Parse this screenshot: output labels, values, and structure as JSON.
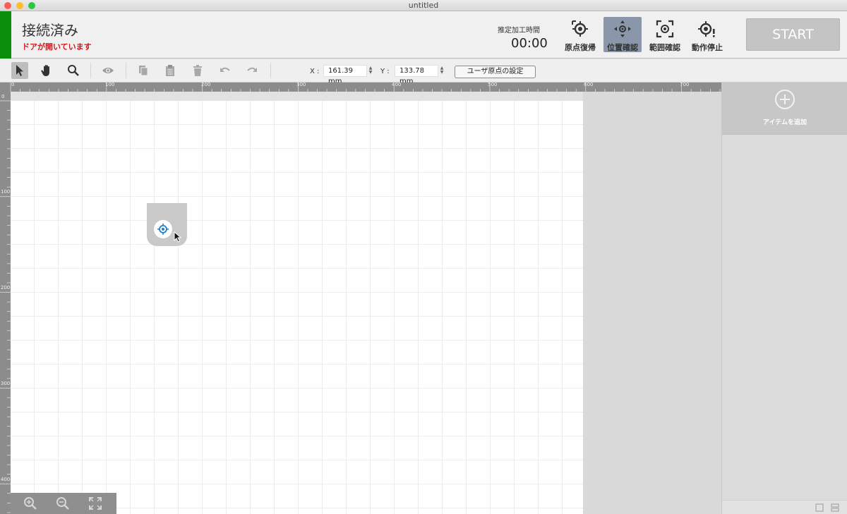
{
  "window": {
    "title": "untitled"
  },
  "status": {
    "connection": "接続済み",
    "warning": "ドアが開いています",
    "estimate_label": "推定加工時間",
    "estimate_time": "00:00",
    "status_color": "#0a8f0a",
    "warning_color": "#d4181c"
  },
  "header_buttons": [
    {
      "label": "原点復帰",
      "icon": "crosshair-home-icon"
    },
    {
      "label": "位置確認",
      "icon": "position-arrows-icon",
      "active": true
    },
    {
      "label": "範囲確認",
      "icon": "frame-target-icon"
    },
    {
      "label": "動作停止",
      "icon": "stop-target-icon"
    }
  ],
  "start_label": "START",
  "toolbar": {
    "tools": [
      "pointer-icon",
      "hand-icon",
      "zoom-icon",
      "eye-icon",
      "copy-icon",
      "paste-icon",
      "trash-icon",
      "undo-icon",
      "redo-icon"
    ],
    "x_label": "X :",
    "x_value": "161.39 mm",
    "y_label": "Y :",
    "y_value": "133.78 mm",
    "origin_button": "ユーザ原点の設定"
  },
  "ruler": {
    "h_ticks": [
      "0",
      "100",
      "200",
      "300",
      "400",
      "500",
      "600",
      "700"
    ],
    "v_ticks": [
      "0",
      "100",
      "200",
      "300",
      "400"
    ]
  },
  "side_panel": {
    "add_label": "アイテムを追加"
  },
  "zoom": [
    "zoom-in-icon",
    "zoom-out-icon",
    "fit-screen-icon"
  ]
}
